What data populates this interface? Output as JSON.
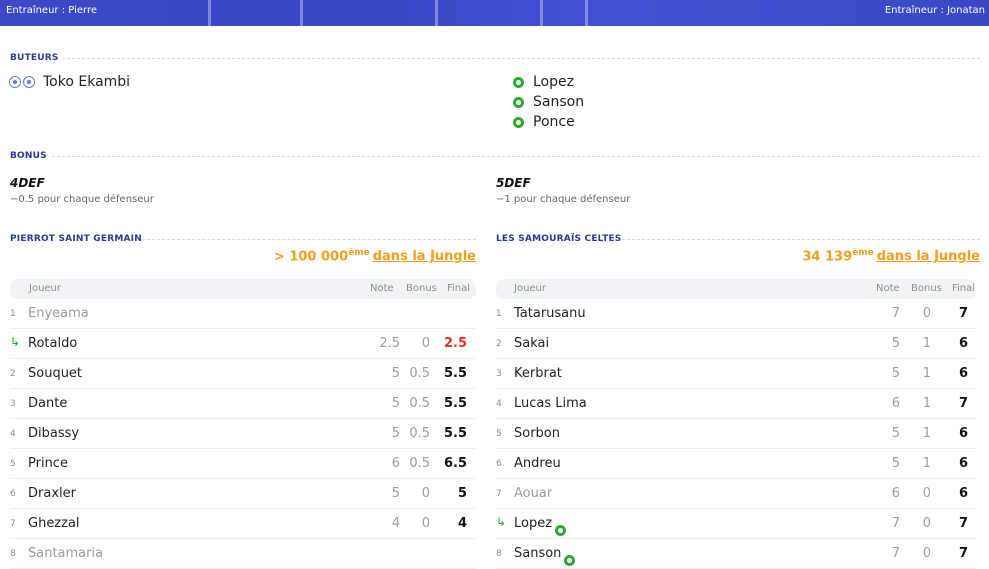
{
  "banner": {
    "coach_left": "Entraîneur : Pierre",
    "coach_right": "Entraîneur : Jonatan"
  },
  "scorers": {
    "heading": "BUTEURS",
    "left": [
      {
        "name": "Toko Ekambi",
        "icon": "double-ball-icon"
      }
    ],
    "right": [
      {
        "name": "Lopez",
        "icon": "goal-ball-icon"
      },
      {
        "name": "Sanson",
        "icon": "goal-ball-icon"
      },
      {
        "name": "Ponce",
        "icon": "goal-ball-icon"
      }
    ]
  },
  "bonus": {
    "heading": "BONUS",
    "left": {
      "code": "4DEF",
      "desc": "−0.5 pour chaque défenseur"
    },
    "right": {
      "code": "5DEF",
      "desc": "−1 pour chaque défenseur"
    }
  },
  "teams": {
    "left": {
      "name": "PIERROT SAINT GERMAIN",
      "rank": "> 100 000",
      "rank_suffix": "ème",
      "jungle": "dans la Jungle",
      "columns": {
        "player": "Joueur",
        "note": "Note",
        "bonus": "Bonus",
        "final": "Final"
      },
      "rows": [
        {
          "idx": "1",
          "name": "Enyeama",
          "note": "",
          "bonus": "",
          "final": "",
          "muted": true
        },
        {
          "idx": "",
          "sub": true,
          "name": "Rotaldo",
          "note": "2.5",
          "bonus": "0",
          "final": "2.5",
          "red": true
        },
        {
          "idx": "2",
          "name": "Souquet",
          "note": "5",
          "bonus": "0.5",
          "final": "5.5"
        },
        {
          "idx": "3",
          "name": "Dante",
          "note": "5",
          "bonus": "0.5",
          "final": "5.5"
        },
        {
          "idx": "4",
          "name": "Dibassy",
          "note": "5",
          "bonus": "0.5",
          "final": "5.5"
        },
        {
          "idx": "5",
          "name": "Prince",
          "note": "6",
          "bonus": "0.5",
          "final": "6.5"
        },
        {
          "idx": "6",
          "name": "Draxler",
          "note": "5",
          "bonus": "0",
          "final": "5"
        },
        {
          "idx": "7",
          "name": "Ghezzal",
          "note": "4",
          "bonus": "0",
          "final": "4"
        },
        {
          "idx": "8",
          "name": "Santamaria",
          "note": "",
          "bonus": "",
          "final": "",
          "muted": true
        }
      ]
    },
    "right": {
      "name": "LES SAMOURAÏS CELTES",
      "rank": "34 139",
      "rank_suffix": "ème",
      "jungle": "dans la Jungle",
      "columns": {
        "player": "Joueur",
        "note": "Note",
        "bonus": "Bonus",
        "final": "Final"
      },
      "rows": [
        {
          "idx": "1",
          "name": "Tatarusanu",
          "note": "7",
          "bonus": "0",
          "final": "7"
        },
        {
          "idx": "2",
          "name": "Sakai",
          "note": "5",
          "bonus": "1",
          "final": "6"
        },
        {
          "idx": "3",
          "name": "Kerbrat",
          "note": "5",
          "bonus": "1",
          "final": "6"
        },
        {
          "idx": "4",
          "name": "Lucas Lima",
          "note": "6",
          "bonus": "1",
          "final": "7"
        },
        {
          "idx": "5",
          "name": "Sorbon",
          "note": "5",
          "bonus": "1",
          "final": "6"
        },
        {
          "idx": "6",
          "name": "Andreu",
          "note": "5",
          "bonus": "1",
          "final": "6"
        },
        {
          "idx": "7",
          "name": "Aouar",
          "note": "6",
          "bonus": "0",
          "final": "6",
          "muted": true
        },
        {
          "idx": "",
          "sub": true,
          "name": "Lopez",
          "note": "7",
          "bonus": "0",
          "final": "7",
          "goal": true
        },
        {
          "idx": "8",
          "name": "Sanson",
          "note": "7",
          "bonus": "0",
          "final": "7",
          "goal": true
        }
      ]
    }
  },
  "colors": {
    "accent": "#f0a01e",
    "heading": "#2b3a8f",
    "banner": "#3b49c9",
    "goal": "#2ca836",
    "negative": "#e0312a"
  }
}
